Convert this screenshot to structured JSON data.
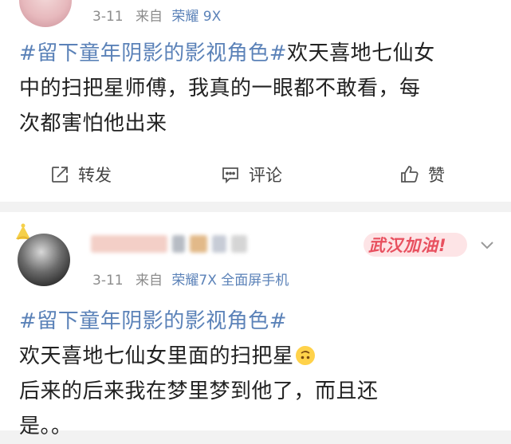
{
  "post1": {
    "time": "3-11",
    "source_prefix": "来自",
    "device": "荣耀 9X",
    "hashtag": "#留下童年阴影的影视角色#",
    "lines": [
      "欢天喜地七仙女",
      "中的扫把星师傅，我真的一眼都不敢看，每",
      "次都害怕他出来"
    ],
    "actions": {
      "repost": "转发",
      "comment": "评论",
      "like": "赞"
    }
  },
  "post2": {
    "time": "3-11",
    "source_prefix": "来自",
    "device": "荣耀7X 全面屏手机",
    "badge": "武汉加油!",
    "hashtag": "#留下童年阴影的影视角色#",
    "lines": [
      "欢天喜地七仙女里面的扫把星",
      "后来的后来我在梦里梦到他了，而且还",
      "是。。"
    ]
  },
  "icons": {
    "repost": "repost-icon",
    "comment": "comment-icon",
    "like": "thumbs-up-icon",
    "chevron": "chevron-down-icon",
    "emoji": "upside-down-face-emoji"
  },
  "colors": {
    "link": "#5b82b8",
    "meta": "#8c8c8c",
    "badge": "#e8505f",
    "divider": "#f2f2f2"
  }
}
